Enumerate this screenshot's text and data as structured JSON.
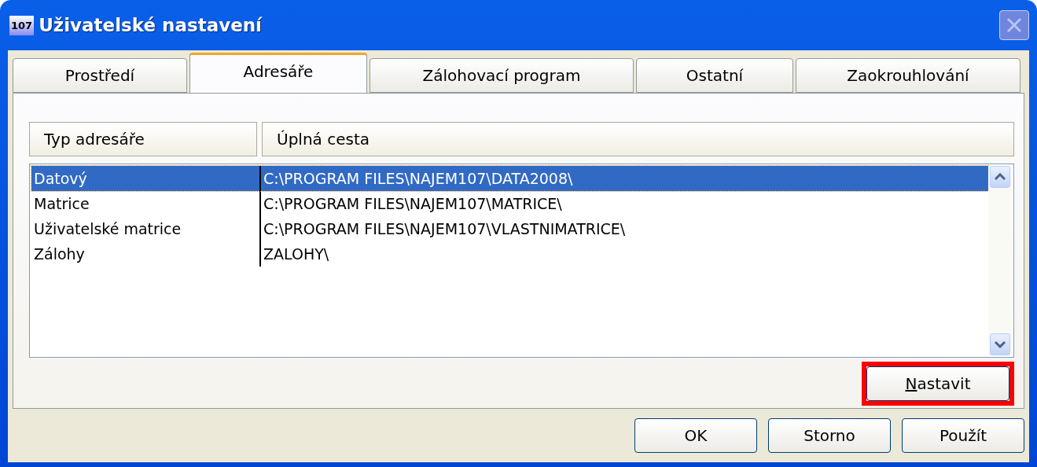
{
  "window": {
    "icon_text": "107",
    "title": "Uživatelské nastavení",
    "close_disabled": true
  },
  "tabs": [
    {
      "label": "Prostředí",
      "selected": false
    },
    {
      "label": "Adresáře",
      "selected": true
    },
    {
      "label": "Zálohovací program",
      "selected": false
    },
    {
      "label": "Ostatní",
      "selected": false
    },
    {
      "label": "Zaokrouhlování",
      "selected": false
    }
  ],
  "table": {
    "columns": [
      "Typ adresáře",
      "Úplná cesta"
    ],
    "rows": [
      {
        "cells": [
          "Datový",
          "C:\\PROGRAM FILES\\NAJEM107\\DATA2008\\"
        ],
        "selected": true
      },
      {
        "cells": [
          "Matrice",
          "C:\\PROGRAM FILES\\NAJEM107\\MATRICE\\"
        ],
        "selected": false
      },
      {
        "cells": [
          "Uživatelské matrice",
          "C:\\PROGRAM FILES\\NAJEM107\\VLASTNIMATRICE\\"
        ],
        "selected": false
      },
      {
        "cells": [
          "Zálohy",
          "ZALOHY\\"
        ],
        "selected": false
      }
    ]
  },
  "set_button": {
    "label": "Nastavit",
    "mnemonic_underlined": true,
    "highlighted": true
  },
  "buttons": [
    "OK",
    "Storno",
    "Použít"
  ]
}
